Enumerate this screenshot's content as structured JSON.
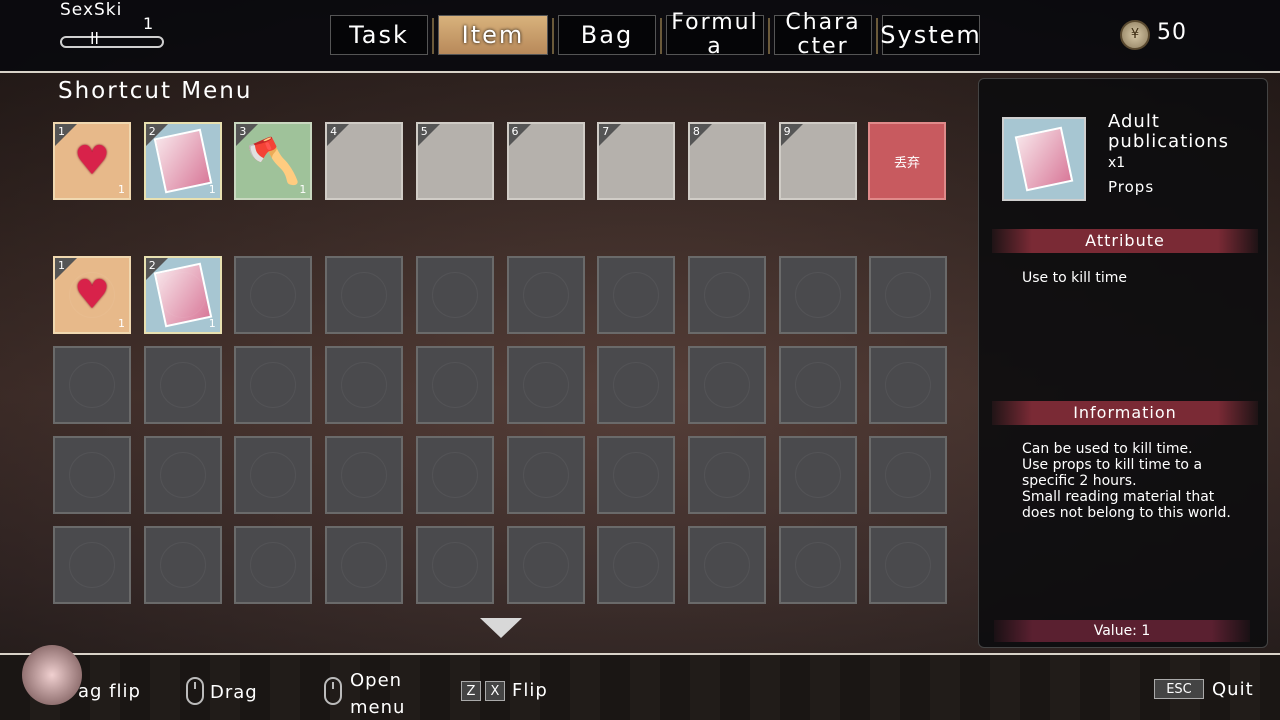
{
  "header": {
    "character_name": "SexSki",
    "skill_level": "1",
    "coin_icon": "coin-icon",
    "coin_count": "50",
    "tabs": [
      {
        "label": "Task",
        "active": false
      },
      {
        "label": "Item",
        "active": true
      },
      {
        "label": "Bag",
        "active": false
      },
      {
        "label": "Formula",
        "active": false
      },
      {
        "label": "Character",
        "active": false
      },
      {
        "label": "System",
        "active": false
      }
    ]
  },
  "shortcut": {
    "title": "Shortcut Menu",
    "slots": [
      {
        "num": "1",
        "qty": "1",
        "item": "heart-gem",
        "bg": "orange"
      },
      {
        "num": "2",
        "qty": "1",
        "item": "adult-publication",
        "bg": "blue"
      },
      {
        "num": "3",
        "qty": "1",
        "item": "axe",
        "bg": "green"
      },
      {
        "num": "4",
        "qty": "",
        "item": "",
        "bg": "light"
      },
      {
        "num": "5",
        "qty": "",
        "item": "",
        "bg": "light"
      },
      {
        "num": "6",
        "qty": "",
        "item": "",
        "bg": "light"
      },
      {
        "num": "7",
        "qty": "",
        "item": "",
        "bg": "light"
      },
      {
        "num": "8",
        "qty": "",
        "item": "",
        "bg": "light"
      },
      {
        "num": "9",
        "qty": "",
        "item": "",
        "bg": "light"
      }
    ],
    "discard_label": "丢弃"
  },
  "inventory": {
    "items": [
      {
        "num": "1",
        "qty": "1",
        "item": "heart-gem",
        "bg": "orange"
      },
      {
        "num": "2",
        "qty": "1",
        "item": "adult-publication",
        "bg": "blue"
      }
    ],
    "empty_slots": 38
  },
  "detail": {
    "name": "Adult publications",
    "qty": "x1",
    "type": "Props",
    "attribute_heading": "Attribute",
    "attribute_text": "Use to kill time",
    "info_heading": "Information",
    "info_text": "Can be used to kill time.\nUse props to kill time to a specific 2 hours.\nSmall reading material that does not belong to this world.",
    "value_label": "Value: 1"
  },
  "footer": {
    "drag_flip_label": "ag flip",
    "drag_label": "Drag",
    "open_menu_label_1": "Open",
    "open_menu_label_2": "menu",
    "key_z": "Z",
    "key_x": "X",
    "flip_label": "Flip",
    "key_esc": "ESC",
    "quit_label": "Quit"
  }
}
